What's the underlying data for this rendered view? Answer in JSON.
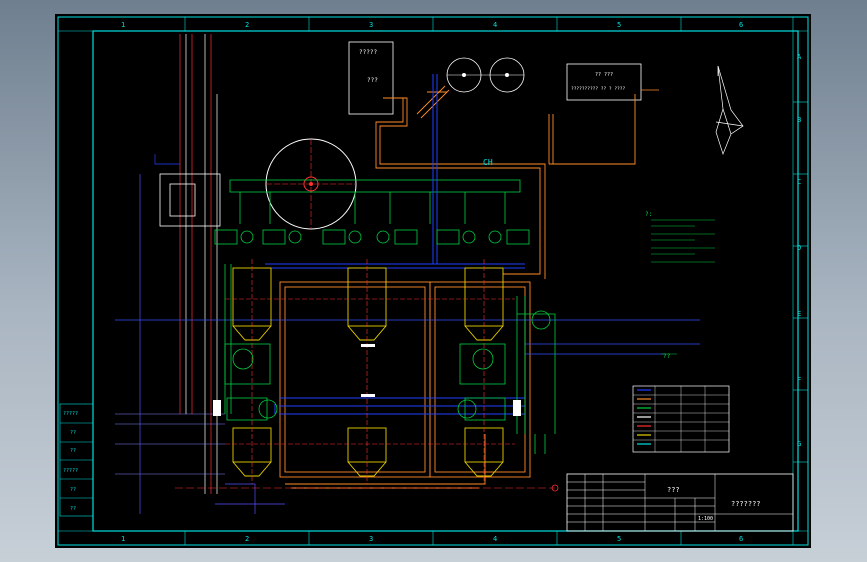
{
  "drawing": {
    "columns": [
      "1",
      "2",
      "3",
      "4",
      "5",
      "6"
    ],
    "rows": [
      "A",
      "B",
      "C",
      "D",
      "E",
      "F",
      "G"
    ],
    "top_tank_label": "?????",
    "top_tank_code": "???",
    "control_box_line1": "?? ???",
    "control_box_line2": "?????????? ??  ? ????",
    "pipe_label": "CH",
    "notes_title": "?:",
    "legend_title": "??",
    "title_block_name": "???",
    "title_block_drawing": "???????",
    "rev_block": [
      "?????",
      "??",
      "??",
      "?????",
      "??",
      "??"
    ],
    "scale": "1:100"
  },
  "colors": {
    "background": "#000000",
    "frame": "#00e0e0",
    "pipe_orange": "#ff8c28",
    "pipe_blue": "#2040ff",
    "equipment_green": "#00d040",
    "vessel_yellow": "#e8d000",
    "centerline_red": "#ff3030"
  }
}
